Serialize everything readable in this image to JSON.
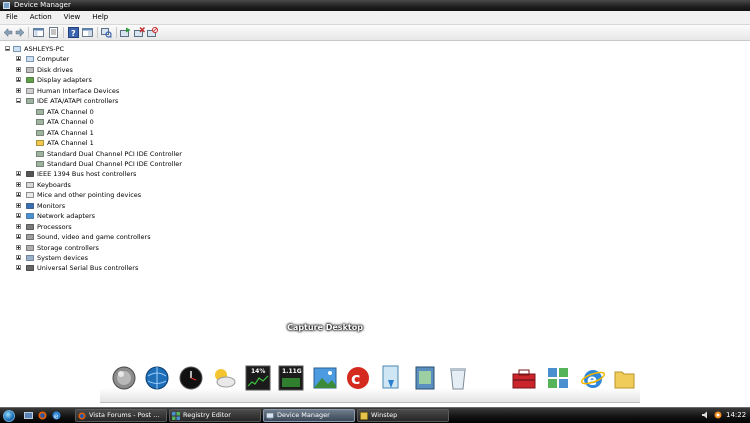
{
  "window": {
    "title": "Device Manager"
  },
  "menu": [
    "File",
    "Action",
    "View",
    "Help"
  ],
  "tree": [
    {
      "label": "ASHLEYS-PC",
      "icon": "computer-icon",
      "level": 0,
      "expander": "minus",
      "name": "tree-root"
    },
    {
      "label": "Computer",
      "icon": "computer-icon",
      "level": 1,
      "expander": "plus",
      "name": "tree-item-computer"
    },
    {
      "label": "Disk drives",
      "icon": "disk-drive-icon",
      "level": 1,
      "expander": "plus",
      "name": "tree-item-disk-drives"
    },
    {
      "label": "Display adapters",
      "icon": "display-adapter-icon",
      "level": 1,
      "expander": "plus",
      "name": "tree-item-display-adapters"
    },
    {
      "label": "Human Interface Devices",
      "icon": "hid-icon",
      "level": 1,
      "expander": "plus",
      "name": "tree-item-human-interface-devices"
    },
    {
      "label": "IDE ATA/ATAPI controllers",
      "icon": "ide-controller-icon",
      "level": 1,
      "expander": "minus",
      "name": "tree-item-ide-ata-atapi-controllers"
    },
    {
      "label": "ATA Channel 0",
      "icon": "ide-controller-icon",
      "level": 2,
      "expander": "",
      "name": "tree-item-ata-channel-0-a"
    },
    {
      "label": "ATA Channel 0",
      "icon": "ide-controller-icon",
      "level": 2,
      "expander": "",
      "name": "tree-item-ata-channel-0-b"
    },
    {
      "label": "ATA Channel 1",
      "icon": "ide-controller-icon",
      "level": 2,
      "expander": "",
      "name": "tree-item-ata-channel-1-a"
    },
    {
      "label": "ATA Channel 1",
      "icon": "ide-controller-warning-icon",
      "level": 2,
      "expander": "",
      "name": "tree-item-ata-channel-1-b"
    },
    {
      "label": "Standard Dual Channel PCI IDE Controller",
      "icon": "ide-controller-icon",
      "level": 2,
      "expander": "",
      "name": "tree-item-pci-ide-controller-a"
    },
    {
      "label": "Standard Dual Channel PCI IDE Controller",
      "icon": "ide-controller-icon",
      "level": 2,
      "expander": "",
      "name": "tree-item-pci-ide-controller-b"
    },
    {
      "label": "IEEE 1394 Bus host controllers",
      "icon": "firewire-icon",
      "level": 1,
      "expander": "plus",
      "name": "tree-item-ieee-1394"
    },
    {
      "label": "Keyboards",
      "icon": "keyboard-icon",
      "level": 1,
      "expander": "plus",
      "name": "tree-item-keyboards"
    },
    {
      "label": "Mice and other pointing devices",
      "icon": "mouse-icon",
      "level": 1,
      "expander": "plus",
      "name": "tree-item-mice"
    },
    {
      "label": "Monitors",
      "icon": "monitor-icon",
      "level": 1,
      "expander": "plus",
      "name": "tree-item-monitors"
    },
    {
      "label": "Network adapters",
      "icon": "network-adapter-icon",
      "level": 1,
      "expander": "plus",
      "name": "tree-item-network-adapters"
    },
    {
      "label": "Processors",
      "icon": "processor-icon",
      "level": 1,
      "expander": "plus",
      "name": "tree-item-processors"
    },
    {
      "label": "Sound, video and game controllers",
      "icon": "sound-icon",
      "level": 1,
      "expander": "plus",
      "name": "tree-item-sound-video-game"
    },
    {
      "label": "Storage controllers",
      "icon": "storage-controller-icon",
      "level": 1,
      "expander": "plus",
      "name": "tree-item-storage-controllers"
    },
    {
      "label": "System devices",
      "icon": "system-devices-icon",
      "level": 1,
      "expander": "plus",
      "name": "tree-item-system-devices"
    },
    {
      "label": "Universal Serial Bus controllers",
      "icon": "usb-icon",
      "level": 1,
      "expander": "plus",
      "name": "tree-item-usb-controllers"
    }
  ],
  "dock": {
    "caption": "Capture Desktop",
    "cpu_meter": "14%",
    "mem_meter": "1.11G"
  },
  "taskbar": {
    "tasks": [
      "Vista Forums - Post ...",
      "Registry Editor",
      "Device Manager",
      "Winstep"
    ],
    "clock": "14:22"
  }
}
